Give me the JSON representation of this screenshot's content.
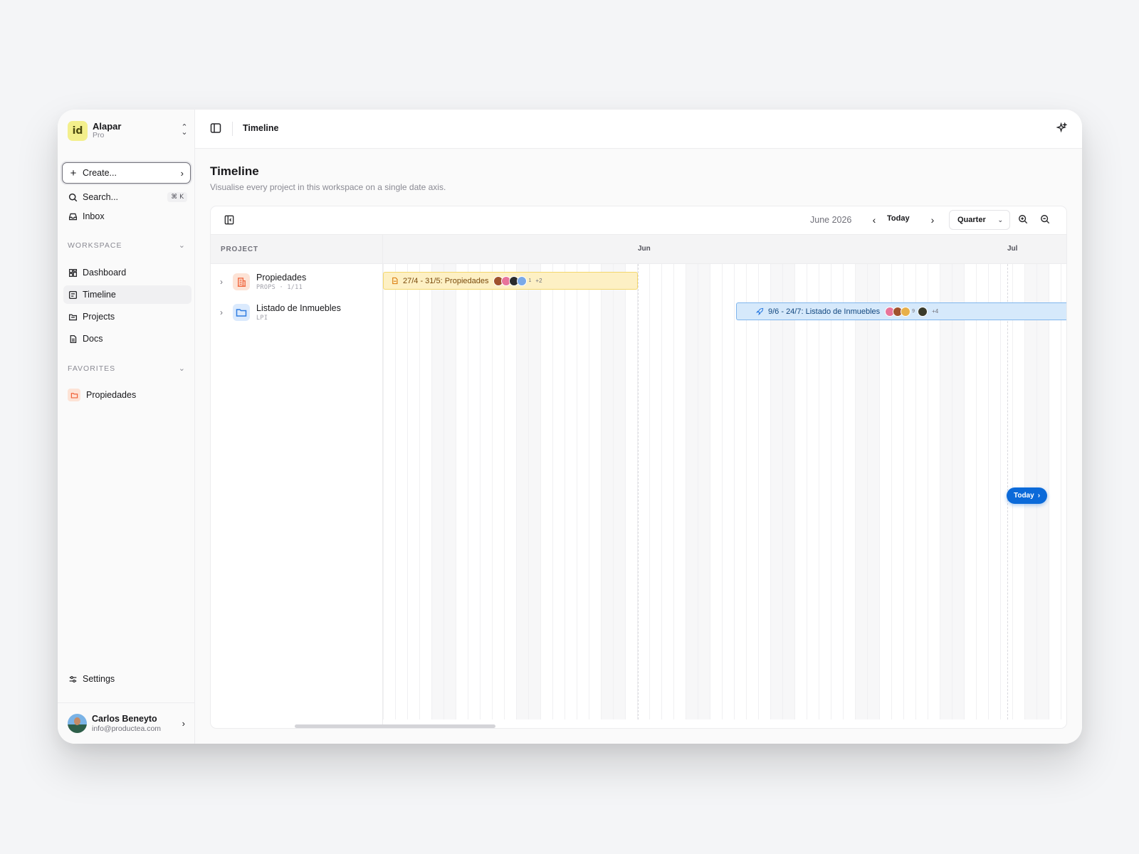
{
  "workspace": {
    "logo_text": "id",
    "name": "Alapar",
    "plan": "Pro"
  },
  "sidebar": {
    "create_label": "Create...",
    "search_label": "Search...",
    "search_shortcut": "⌘ K",
    "inbox_label": "Inbox",
    "workspace_section": "WORKSPACE",
    "items": [
      {
        "label": "Dashboard",
        "icon": "grid-icon"
      },
      {
        "label": "Timeline",
        "icon": "timeline-icon",
        "active": true
      },
      {
        "label": "Projects",
        "icon": "folders-icon"
      },
      {
        "label": "Docs",
        "icon": "doc-icon"
      }
    ],
    "favorites_section": "FAVORITES",
    "favorites": [
      {
        "label": "Propiedades",
        "icon": "folder-icon",
        "color": "#f97f4a"
      }
    ],
    "settings_label": "Settings"
  },
  "user": {
    "name": "Carlos Beneyto",
    "email": "info@productea.com"
  },
  "topbar": {
    "title": "Timeline"
  },
  "page": {
    "title": "Timeline",
    "subtitle": "Visualise every project in this workspace on a single date axis."
  },
  "toolbar": {
    "current_period": "June 2026",
    "today_label": "Today",
    "scale": "Quarter"
  },
  "table": {
    "project_header": "PROJECT",
    "projects": [
      {
        "name": "Propiedades",
        "meta": "PROPS · 1/11",
        "icon": "building-icon",
        "color": "#f0633a"
      },
      {
        "name": "Listado de Inmuebles",
        "meta": "LPI",
        "icon": "folder-icon",
        "color": "#2f7de1"
      }
    ]
  },
  "timeline": {
    "months": [
      "Jun",
      "Jul"
    ],
    "bars": [
      {
        "label": "27/4 - 31/5: Propiedades",
        "icon": "doc-icon",
        "color": "#fdf0c4",
        "avatar_count": "1",
        "more": "+2"
      },
      {
        "label": "9/6 - 24/7: Listado de Inmuebles",
        "icon": "rocket-icon",
        "color": "#d6e9fb",
        "avatar_count": "9",
        "more": "+4"
      }
    ],
    "today_pill": "Today"
  },
  "colors": {
    "accent": "#0b6ad9",
    "bar_yellow": "#fdf0c4",
    "bar_blue": "#d6e9fb"
  }
}
